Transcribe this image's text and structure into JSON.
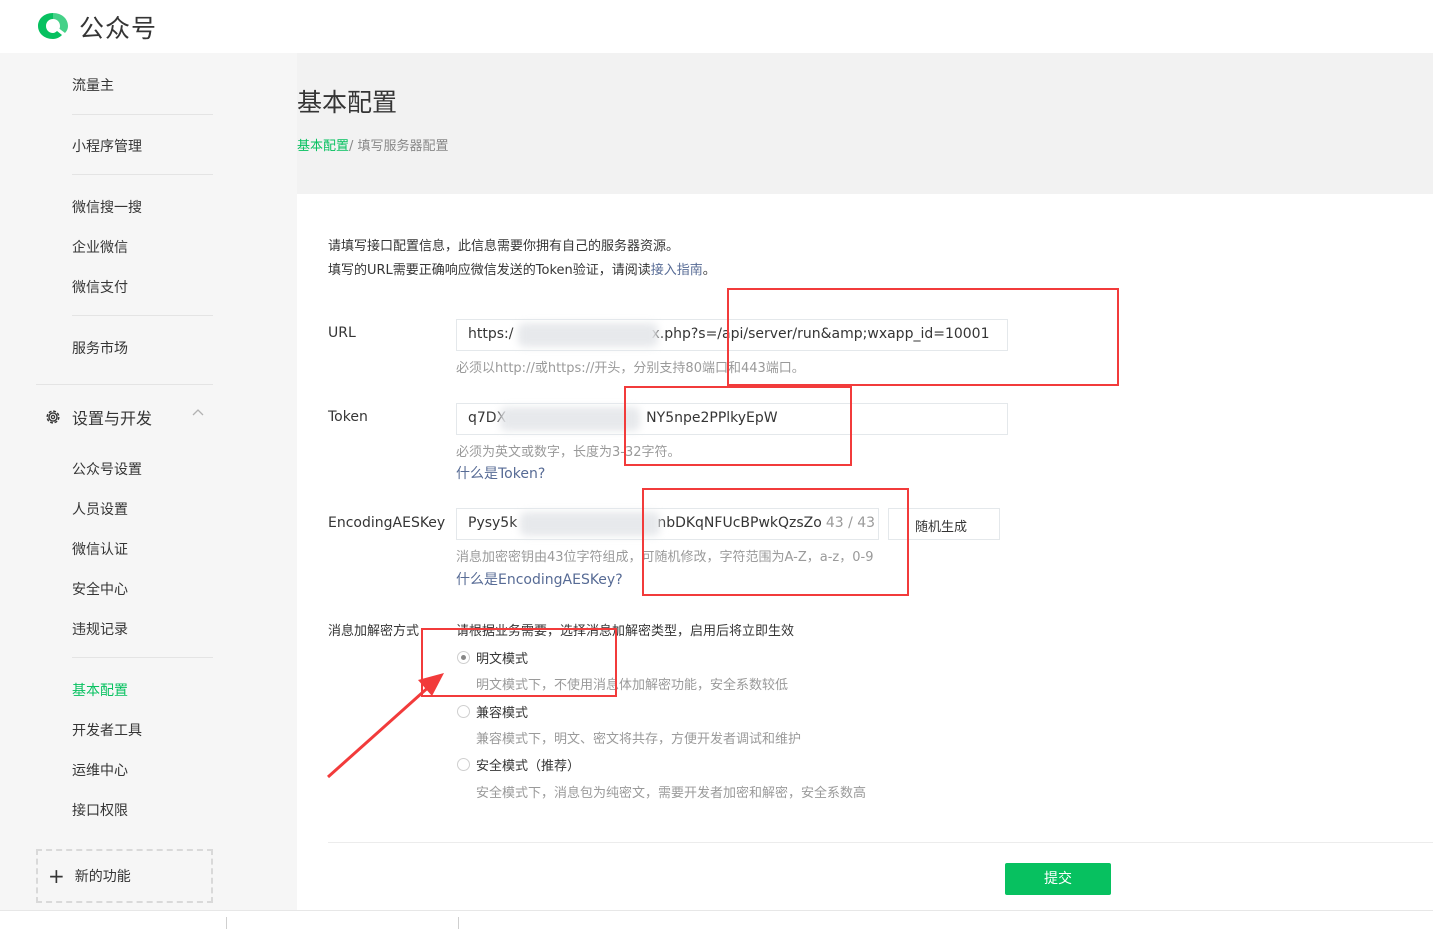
{
  "header": {
    "app_name": "公众号"
  },
  "sidebar": {
    "items": [
      {
        "label": "流量主"
      },
      {
        "label": "小程序管理"
      },
      {
        "label": "微信搜一搜"
      },
      {
        "label": "企业微信"
      },
      {
        "label": "微信支付"
      },
      {
        "label": "服务市场"
      }
    ],
    "section_title": "设置与开发",
    "sub_items": [
      {
        "label": "公众号设置"
      },
      {
        "label": "人员设置"
      },
      {
        "label": "微信认证"
      },
      {
        "label": "安全中心"
      },
      {
        "label": "违规记录"
      },
      {
        "label": "基本配置",
        "active": true
      },
      {
        "label": "开发者工具"
      },
      {
        "label": "运维中心"
      },
      {
        "label": "接口权限"
      }
    ],
    "new_function_label": "新的功能"
  },
  "page": {
    "title": "基本配置",
    "breadcrumb": {
      "link": "基本配置",
      "current": "/ 填写服务器配置"
    }
  },
  "form": {
    "intro_line1": "请填写接口配置信息，此信息需要你拥有自己的服务器资源。",
    "intro_line2_prefix": "填写的URL需要正确响应微信发送的Token验证，请阅读",
    "intro_link": "接入指南",
    "intro_line2_suffix": "。",
    "url": {
      "label": "URL",
      "value_prefix": "https:/",
      "value_suffix": "x.php?s=/api/server/run&amp;wxapp_id=10001",
      "hint": "必须以http://或https://开头，分别支持80端口和443端口。"
    },
    "token": {
      "label": "Token",
      "value_prefix": "q7DX",
      "value_suffix": "NY5npe2PPlkyEpW",
      "hint": "必须为英文或数字，长度为3-32字符。",
      "help_link": "什么是Token?"
    },
    "aes": {
      "label": "EncodingAESKey",
      "value_prefix": "Pysy5k",
      "value_suffix": "nbDKqNFUcBPwkQzsZo",
      "count": "43 / 43",
      "random_button": "随机生成",
      "hint": "消息加密密钥由43位字符组成，可随机修改，字符范围为A-Z，a-z，0-9",
      "help_link": "什么是EncodingAESKey?"
    },
    "encryption": {
      "label": "消息加解密方式",
      "tip": "请根据业务需要，选择消息加解密类型，启用后将立即生效",
      "options": [
        {
          "label": "明文模式",
          "desc": "明文模式下，不使用消息体加解密功能，安全系数较低",
          "checked": true
        },
        {
          "label": "兼容模式",
          "desc": "兼容模式下，明文、密文将共存，方便开发者调试和维护",
          "checked": false
        },
        {
          "label": "安全模式（推荐）",
          "desc": "安全模式下，消息包为纯密文，需要开发者加密和解密，安全系数高",
          "checked": false
        }
      ]
    },
    "submit_label": "提交"
  },
  "colors": {
    "accent": "#07c160",
    "link": "#576b95",
    "annotation": "#f23b3b"
  }
}
